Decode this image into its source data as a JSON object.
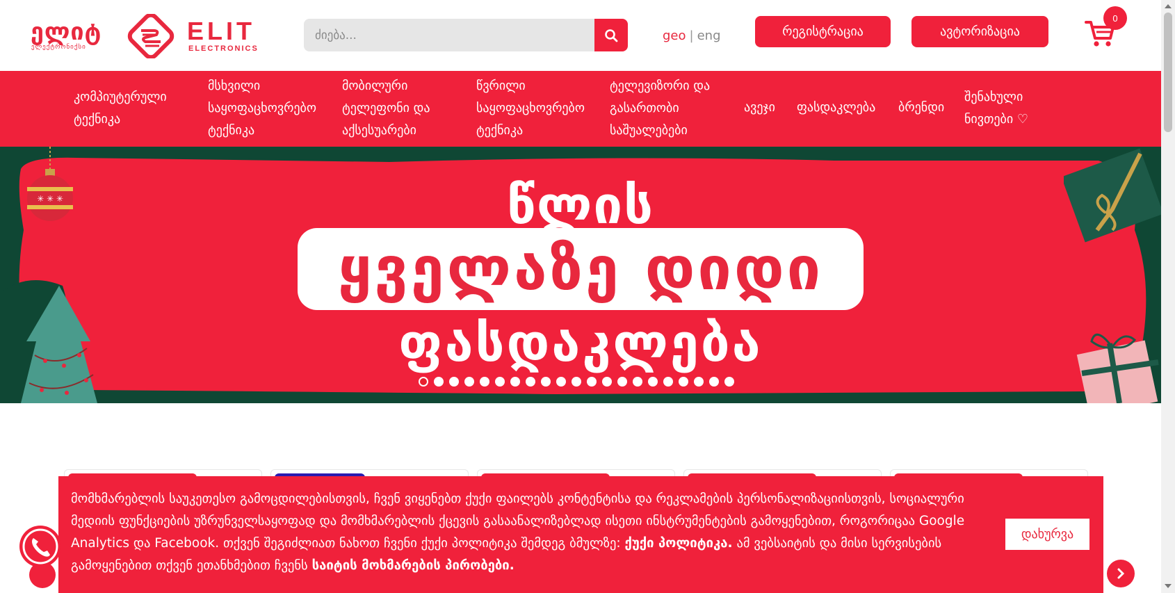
{
  "header": {
    "logo_geo": "ელიტ",
    "logo_geo_sub": "ელექტრონიქსი",
    "logo_latin": "ELIT",
    "logo_latin_sub": "ELECTRONICS",
    "search_placeholder": "ძიება...",
    "lang_geo": "geo",
    "lang_sep": "|",
    "lang_eng": "eng",
    "register_label": "რეგისტრაცია",
    "login_label": "ავტორიზაცია",
    "cart_count": "0"
  },
  "nav": {
    "items": [
      "კომპიუტერული ტექნიკა",
      "მსხვილი საყოფაცხოვრებო ტექნიკა",
      "მობილური ტელეფონი და აქსესუარები",
      "წვრილი საყოფაცხოვრებო ტექნიკა",
      "ტელევიზორი და გასართობი საშუალებები",
      "ავეჯი",
      "ფასდაკლება",
      "ბრენდი",
      "შენახული ნივთები ♡"
    ]
  },
  "banner": {
    "line1": "წლის",
    "line2": "ყველაზე დიდი",
    "line3": "ფასდაკლება",
    "slide_count": 21,
    "active_slide": 1
  },
  "cookie": {
    "text_main": "მომხმარებლის საუკეთესო გამოცდილებისთვის, ჩვენ ვიყენებთ ქუქი ფაილებს კონტენტისა და რეკლამების პერსონალიზაციისთვის, სოციალური მედიის ფუნქციების უზრუნველსაყოფად და მომხმარებლის ქცევის გასაანალიზებლად ისეთი ინსტრუმენტების გამოყენებით, როგორიცაა Google Analytics და Facebook. თქვენ შეგიძლიათ ნახოთ ჩვენი ქუქი პოლიტიკა შემდეგ ბმულზე:",
    "policy_link": "ქუქი პოლიტიკა.",
    "text_mid": "ამ ვებსაიტის და მისი სერვისების გამოყენებით თქვენ ეთანხმებით ჩვენს",
    "terms_link": "საიტის მოხმარების პირობები.",
    "close_label": "დახურვა"
  },
  "colors": {
    "brand_red": "#f0213b",
    "banner_green": "#0f4734"
  }
}
